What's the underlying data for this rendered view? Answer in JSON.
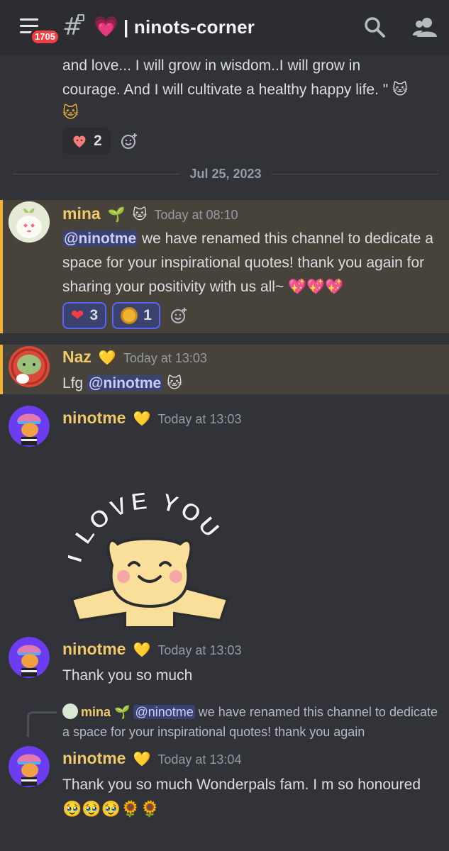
{
  "header": {
    "notification_count": "1705",
    "channel_emoji": "💗",
    "channel_separator": "|",
    "channel_name": "ninots-corner"
  },
  "prev_message": {
    "text_line1": "and love... I will grow in wisdom..I will grow in",
    "text_line2": "courage. And I will cultivate a healthy happy life. \" 🐱",
    "text_line3": "🐱",
    "reactions": [
      {
        "emoji": "heart-face",
        "count": "2",
        "selected": false
      }
    ]
  },
  "date_separator": "Jul 25, 2023",
  "messages": [
    {
      "id": "mina",
      "username": "mina",
      "badges": [
        "🌱",
        "🐱"
      ],
      "timestamp": "Today at 08:10",
      "mention": "@ninotme",
      "text_after_mention": " we have renamed this channel to dedicate a space for your inspirational quotes! thank you again for sharing your positivity with us all~ ",
      "trailing_emojis": "💖💖💖",
      "reactions": [
        {
          "emoji": "❤️",
          "count": "3",
          "selected": true
        },
        {
          "emoji": "coin",
          "count": "1",
          "selected": true
        }
      ]
    },
    {
      "id": "naz",
      "username": "Naz",
      "badges": [
        "💛"
      ],
      "timestamp": "Today at 13:03",
      "text_before": "Lfg ",
      "mention": "@ninotme",
      "trailing_emojis": "🐱"
    },
    {
      "id": "ninotme-sticker",
      "username": "ninotme",
      "badges": [
        "💛"
      ],
      "timestamp": "Today at 13:03",
      "sticker_text": "I LOVE YOU"
    },
    {
      "id": "ninotme-thanks",
      "username": "ninotme",
      "badges": [
        "💛"
      ],
      "timestamp": "Today at 13:03",
      "text": "Thank you so much"
    },
    {
      "id": "ninotme-reply",
      "reply": {
        "username": "mina",
        "badge": "🌱",
        "mention": "@ninotme",
        "text": " we have renamed this channel to dedicate a space for your inspirational quotes! thank you again"
      },
      "username": "ninotme",
      "badges": [
        "💛"
      ],
      "timestamp": "Today at 13:04",
      "text": "Thank you so much Wonderpals fam. I m so honoured",
      "trailing_emojis": "🥹🥹🥹🌻🌻"
    }
  ]
}
